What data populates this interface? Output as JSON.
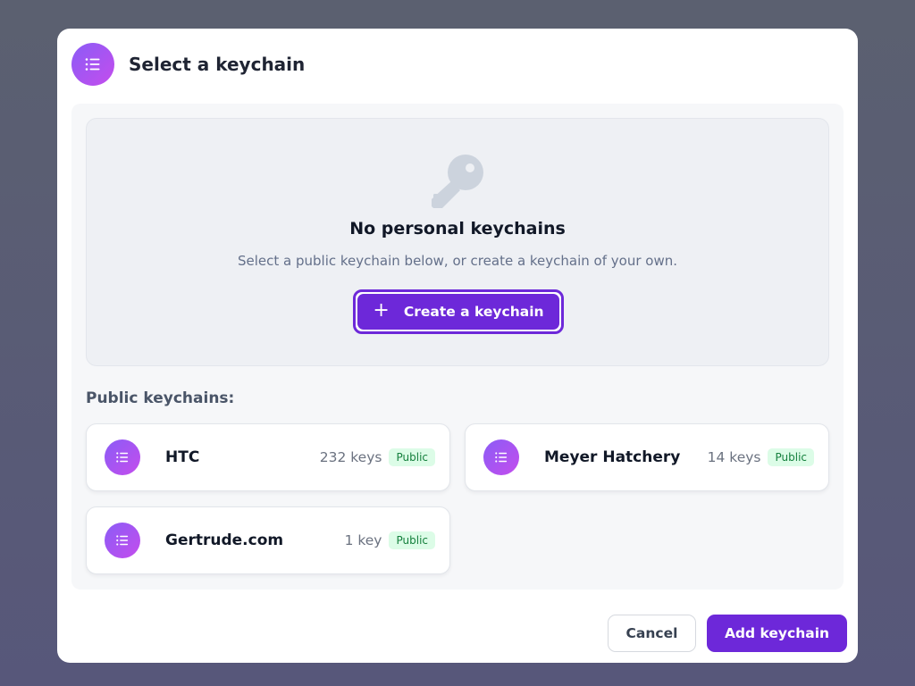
{
  "modal": {
    "title": "Select a keychain",
    "header_icon": "list-icon"
  },
  "empty_state": {
    "icon": "key-icon",
    "title": "No personal keychains",
    "subtitle": "Select a public keychain below, or create a keychain of your own.",
    "create_button": {
      "icon": "plus-icon",
      "icon_glyph": "+",
      "label": "Create a keychain"
    }
  },
  "public_section": {
    "label": "Public keychains:",
    "keychains": [
      {
        "name": "HTC",
        "count": "232 keys",
        "badge": "Public",
        "icon": "list-icon"
      },
      {
        "name": "Meyer Hatchery",
        "count": "14 keys",
        "badge": "Public",
        "icon": "list-icon"
      },
      {
        "name": "Gertrude.com",
        "count": "1 key",
        "badge": "Public",
        "icon": "list-icon"
      }
    ]
  },
  "footer": {
    "cancel_label": "Cancel",
    "add_label": "Add keychain"
  },
  "colors": {
    "accent": "#6d28d9",
    "badge_bg": "#dcfce7",
    "badge_text": "#15803d",
    "icon_gradient_start": "#8b5cf6",
    "icon_gradient_end": "#c44ded"
  }
}
